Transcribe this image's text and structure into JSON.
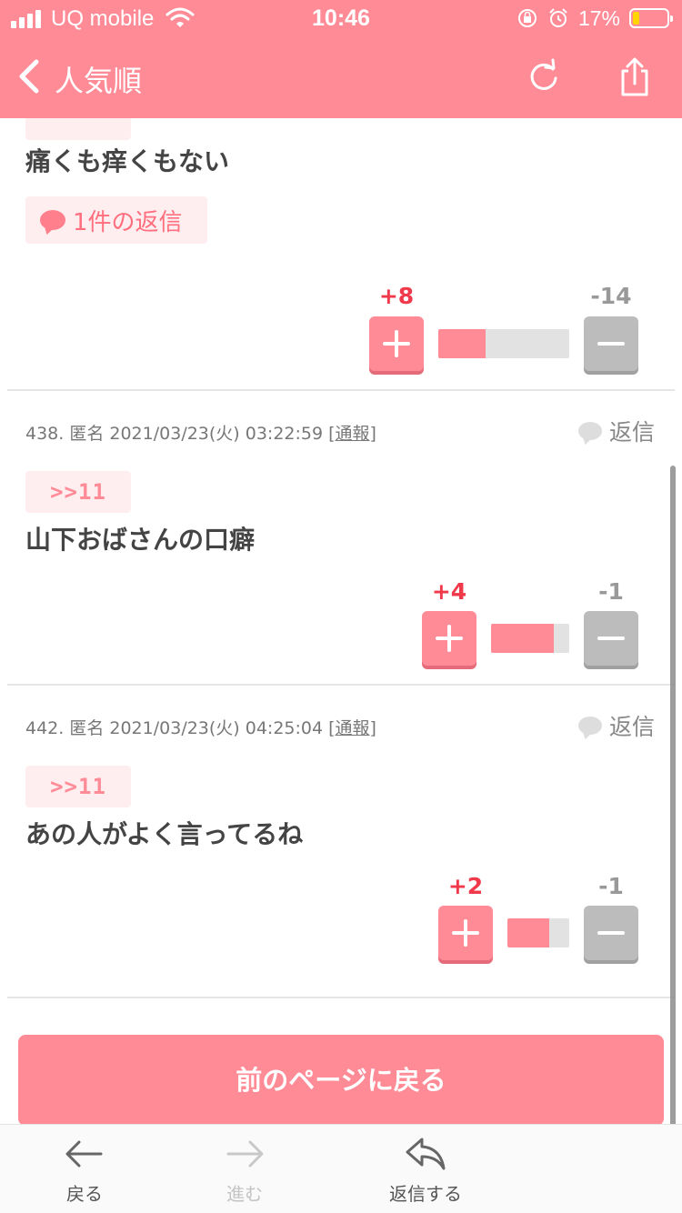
{
  "status_bar": {
    "carrier": "UQ mobile",
    "time": "10:46",
    "battery_percent": "17%",
    "battery_level": 0.17
  },
  "navbar": {
    "title": "人気順",
    "icons": [
      "chevron-left-icon",
      "reload-icon",
      "share-icon"
    ]
  },
  "top_comment": {
    "text": "痛くも痒くもない",
    "reply_count_label": "1件の返信",
    "plus": "+8",
    "minus": "-14",
    "plus_ratio": 0.36
  },
  "comments": [
    {
      "meta": "438. 匿名 2021/03/23(火) 03:22:59 ",
      "report": "[通報]",
      "reply_label": "返信",
      "anchor": ">>11",
      "text": "山下おばさんの口癖",
      "plus": "+4",
      "minus": "-1",
      "plus_ratio": 0.8
    },
    {
      "meta": "442. 匿名 2021/03/23(火) 04:25:04 ",
      "report": "[通報]",
      "reply_label": "返信",
      "anchor": ">>11",
      "text": "あの人がよく言ってるね",
      "plus": "+2",
      "minus": "-1",
      "plus_ratio": 0.67
    }
  ],
  "prev_page_button": "前のページに戻る",
  "toolbar": {
    "back": "戻る",
    "forward": "進む",
    "reply": "返信する"
  },
  "colors": {
    "accent": "#ff8b97",
    "plus_text": "#f03a4b",
    "minus_button": "#bcbcbc"
  }
}
